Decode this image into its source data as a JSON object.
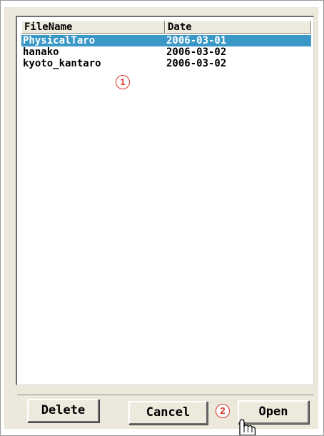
{
  "file_list": {
    "columns": [
      "FileName",
      "Date"
    ],
    "rows": [
      {
        "name": "PhysicalTaro",
        "date": "2006-03-01",
        "selected": true
      },
      {
        "name": "hanako",
        "date": "2006-03-02",
        "selected": false
      },
      {
        "name": "kyoto_kantaro",
        "date": "2006-03-02",
        "selected": false
      }
    ]
  },
  "buttons": {
    "delete": "Delete",
    "cancel": "Cancel",
    "open": "Open"
  },
  "annotations": {
    "marker_1": "1",
    "marker_2": "2"
  },
  "colors": {
    "selection": "#3a98c7",
    "marker": "#d9362b"
  },
  "icons": {
    "cursor": "hand-pointer-icon"
  }
}
